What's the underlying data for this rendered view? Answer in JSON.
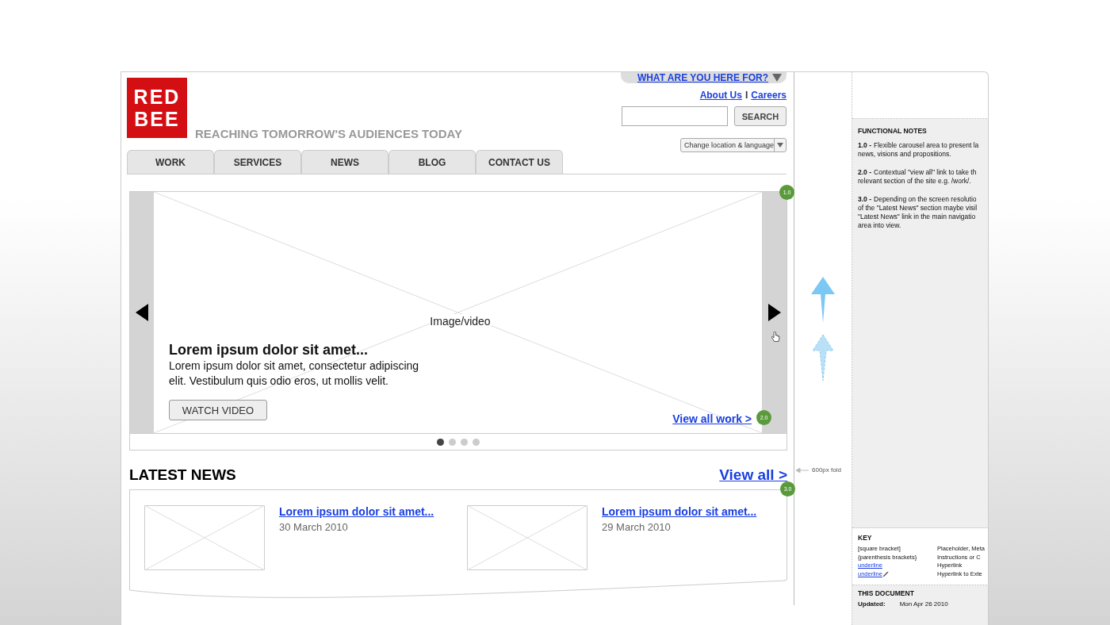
{
  "header": {
    "logo": [
      "RED",
      "BEE"
    ],
    "tagline": "REACHING TOMORROW'S AUDIENCES TODAY",
    "audience_menu": "WHAT ARE YOU HERE FOR?",
    "top_links": [
      "About Us",
      "Careers"
    ],
    "separator": "I",
    "search_button": "SEARCH",
    "location_select": "Change location & language"
  },
  "nav_tabs": [
    "WORK",
    "SERVICES",
    "NEWS",
    "BLOG",
    "CONTACT US"
  ],
  "carousel": {
    "badge": "1.0",
    "image_label": "Image/video",
    "headline": "Lorem ipsum dolor sit amet...",
    "body": "Lorem ipsum dolor sit amet, consectetur adipiscing elit. Vestibulum quis odio eros, ut mollis velit.",
    "button": "WATCH VIDEO",
    "link": "View all work >",
    "link_badge": "2.0",
    "dots": [
      {
        "selected": true
      },
      {
        "selected": false
      },
      {
        "selected": false
      },
      {
        "selected": false
      }
    ]
  },
  "latest_news": {
    "title": "LATEST NEWS",
    "link": "View all >",
    "badge": "3.0",
    "items": [
      {
        "title": "Lorem ipsum dolor sit amet...",
        "date": "30 March 2010"
      },
      {
        "title": "Lorem ipsum dolor sit amet...",
        "date": "29 March 2010"
      }
    ]
  },
  "fold_label": "600px fold",
  "functional_notes": {
    "title": "FUNCTIONAL NOTES",
    "notes": [
      {
        "num": "1.0 -",
        "lines": [
          "Flexible carousel area to present la",
          "news, visions and propositions."
        ]
      },
      {
        "num": "2.0 -",
        "lines": [
          "Contextual \"view all\" link to take th",
          "relevant section of the site e.g. /work/."
        ]
      },
      {
        "num": "3.0 -",
        "lines": [
          "Depending on the screen resolutio",
          "of the \"Latest News\" section maybe visil",
          "\"Latest News\" link in the main navigatio",
          "area into view."
        ]
      }
    ]
  },
  "key": {
    "title": "KEY",
    "rows": [
      {
        "kind": "text",
        "sample": "[square bracket]",
        "meaning": "Placeholder, Meta"
      },
      {
        "kind": "text",
        "sample": "{parenthesis brackets}",
        "meaning": "Instructions or C"
      },
      {
        "kind": "link",
        "sample": "underline",
        "meaning": "Hyperlink"
      },
      {
        "kind": "external",
        "sample": "underline",
        "meaning": "Hyperlink to Exte"
      }
    ]
  },
  "this_document": {
    "title": "THIS DOCUMENT",
    "label": "Updated:",
    "value": "Mon Apr 26 2010"
  }
}
